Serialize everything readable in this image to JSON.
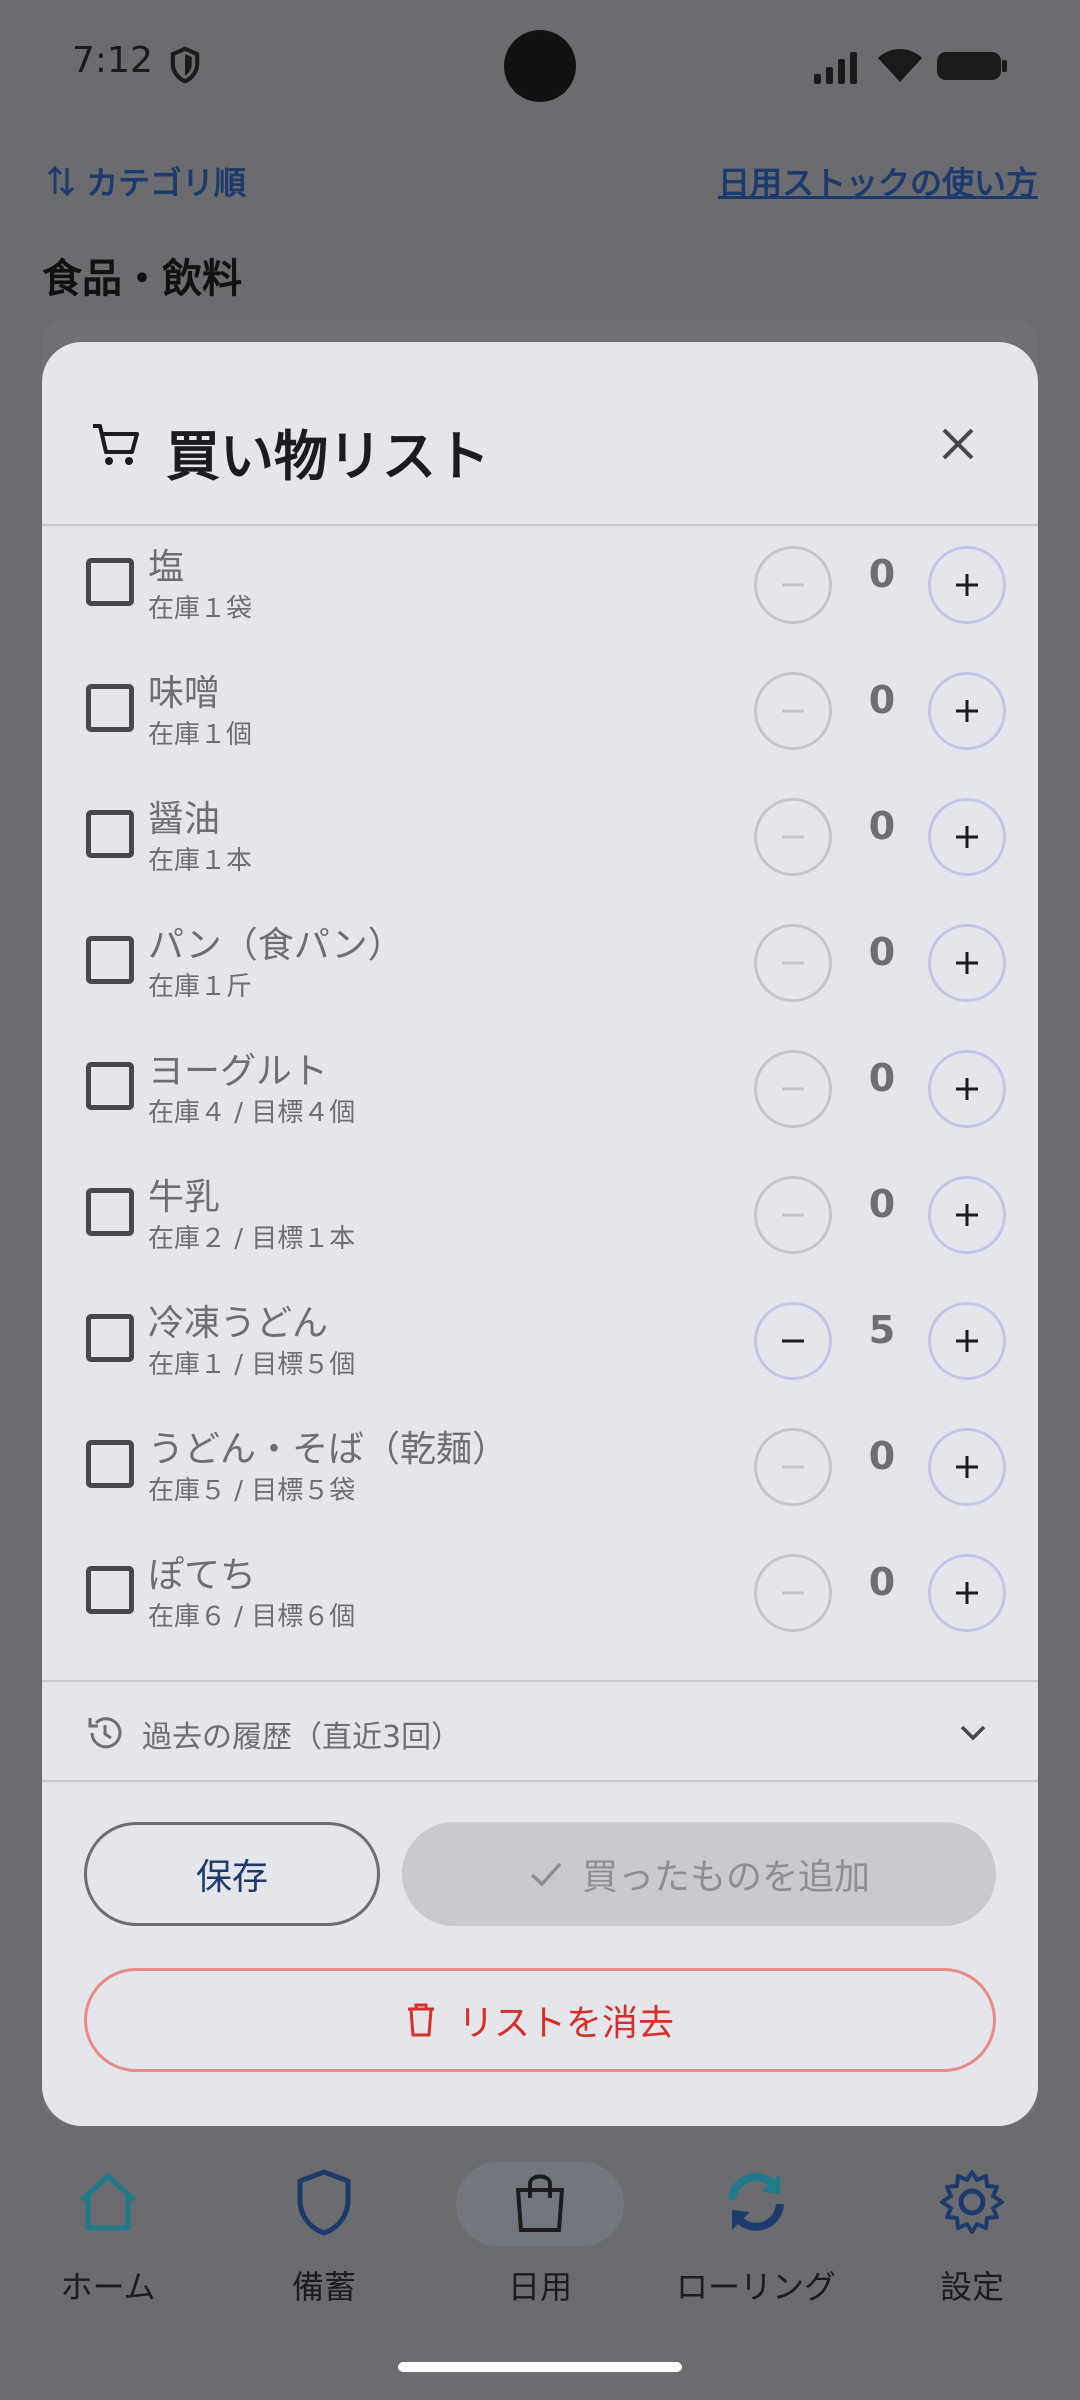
{
  "status_bar": {
    "time": "7:12"
  },
  "page": {
    "sort_label": "カテゴリ順",
    "help_link": "日用ストックの使い方",
    "section_title": "食品・飲料"
  },
  "modal": {
    "title": "買い物リスト",
    "items": [
      {
        "name": "塩",
        "stock": "在庫１袋",
        "qty": "0"
      },
      {
        "name": "味噌",
        "stock": "在庫１個",
        "qty": "0"
      },
      {
        "name": "醤油",
        "stock": "在庫１本",
        "qty": "0"
      },
      {
        "name": "パン（食パン）",
        "stock": "在庫１斤",
        "qty": "0"
      },
      {
        "name": "ヨーグルト",
        "stock": "在庫４ / 目標４個",
        "qty": "0"
      },
      {
        "name": "牛乳",
        "stock": "在庫２ / 目標１本",
        "qty": "0"
      },
      {
        "name": "冷凍うどん",
        "stock": "在庫１ / 目標５個",
        "qty": "5"
      },
      {
        "name": "うどん・そば（乾麺）",
        "stock": "在庫５ / 目標５袋",
        "qty": "0"
      },
      {
        "name": "ぽてち",
        "stock": "在庫６ / 目標６個",
        "qty": "0"
      }
    ],
    "history_label": "過去の履歴（直近3回）",
    "save_label": "保存",
    "add_bought_label": "買ったものを追加",
    "clear_label": "リストを消去"
  },
  "nav": {
    "home": "ホーム",
    "stockpile": "備蓄",
    "daily": "日用",
    "rolling": "ローリング",
    "settings": "設定"
  },
  "colors": {
    "modal_bg": "#e5e6ec",
    "link": "#1c3a6b",
    "danger": "#d92f2a",
    "teal": "#1f7a8a"
  }
}
